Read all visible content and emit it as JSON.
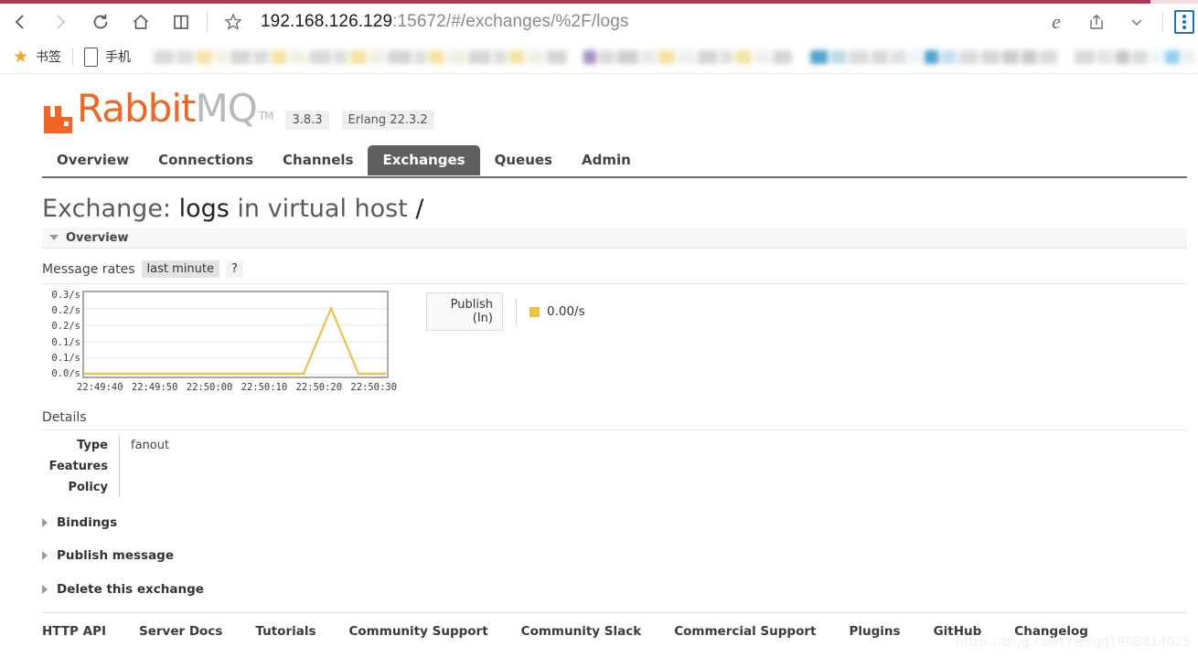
{
  "browser": {
    "loading_percent": 96,
    "back_icon": "back-chevron-icon",
    "forward_icon": "forward-chevron-icon",
    "reload_icon": "reload-icon",
    "home_icon": "home-icon",
    "reading_list_icon": "book-icon",
    "favorite_icon": "star-outline-icon",
    "url_host": "192.168.126.129",
    "url_rest": ":15672/#/exchanges/%2F/logs",
    "edge_icon": "edge-logo-icon",
    "share_icon": "share-icon",
    "more_icon": "chevron-down-icon",
    "extension_icon": "extension-icon"
  },
  "bookmarks": {
    "star_icon": "star-filled-icon",
    "bookmarks_label": "书签",
    "mobile_icon": "phone-icon",
    "mobile_label": "手机",
    "blurred_chips": [
      {
        "w": 34,
        "c": "#d8d8d8"
      },
      {
        "w": 30,
        "c": "#dedede"
      },
      {
        "w": 26,
        "c": "#f3e3a8"
      },
      {
        "w": 22,
        "c": "#f3f0e4"
      },
      {
        "w": 34,
        "c": "#d5d5d5"
      },
      {
        "w": 26,
        "c": "#dcdcdc"
      },
      {
        "w": 24,
        "c": "#f4e2a0"
      },
      {
        "w": 30,
        "c": "#f2efe6"
      },
      {
        "w": 36,
        "c": "#d9d9d9"
      },
      {
        "w": 24,
        "c": "#dddddd"
      },
      {
        "w": 28,
        "c": "#f4e3a2"
      },
      {
        "w": 26,
        "c": "#f1eee6"
      },
      {
        "w": 40,
        "c": "#d4d4d4"
      },
      {
        "w": 20,
        "c": "#dedede"
      },
      {
        "w": 26,
        "c": "#f4e2a0"
      },
      {
        "w": 32,
        "c": "#f0ede5"
      },
      {
        "w": 38,
        "c": "#d6d6d6"
      },
      {
        "w": 22,
        "c": "#dcdcdc"
      },
      {
        "w": 24,
        "c": "#f3e2a2"
      },
      {
        "w": 30,
        "c": "#f1eee7"
      },
      {
        "w": 34,
        "c": "#d6d6d6"
      },
      {
        "w": 18,
        "c": "#ffffff"
      },
      {
        "w": 22,
        "c": "#a98ec4"
      },
      {
        "w": 26,
        "c": "#d9d9d9"
      },
      {
        "w": 36,
        "c": "#cfcfcf"
      },
      {
        "w": 24,
        "c": "#e8e8e8"
      },
      {
        "w": 28,
        "c": "#f3e2a2"
      },
      {
        "w": 30,
        "c": "#efefef"
      },
      {
        "w": 34,
        "c": "#d4d4d4"
      },
      {
        "w": 20,
        "c": "#dedede"
      },
      {
        "w": 26,
        "c": "#f2e2a4"
      },
      {
        "w": 28,
        "c": "#f0f0ee"
      },
      {
        "w": 32,
        "c": "#d5d5d5"
      },
      {
        "w": 22,
        "c": "#ffffff"
      },
      {
        "w": 30,
        "c": "#4fa3cd"
      },
      {
        "w": 26,
        "c": "#bdd9e8"
      },
      {
        "w": 34,
        "c": "#dcdcdc"
      },
      {
        "w": 28,
        "c": "#d8d8d8"
      },
      {
        "w": 26,
        "c": "#e0e0e0"
      },
      {
        "w": 22,
        "c": "#eef5f8"
      },
      {
        "w": 22,
        "c": "#4fa3cd"
      },
      {
        "w": 26,
        "c": "#c3dded"
      },
      {
        "w": 34,
        "c": "#dcdcdc"
      },
      {
        "w": 30,
        "c": "#d6d6d6"
      },
      {
        "w": 28,
        "c": "#cccccc"
      },
      {
        "w": 26,
        "c": "#c9c9c9"
      },
      {
        "w": 30,
        "c": "#dadada"
      },
      {
        "w": 20,
        "c": "#ffffff"
      },
      {
        "w": 34,
        "c": "#d9d9d9"
      },
      {
        "w": 26,
        "c": "#e4e4e4"
      },
      {
        "w": 24,
        "c": "#c6c6c6"
      },
      {
        "w": 26,
        "c": "#dbdbdb"
      },
      {
        "w": 20,
        "c": "#e9f5fb"
      },
      {
        "w": 24,
        "c": "#8fd0ee"
      },
      {
        "w": 22,
        "c": "#eeeeee"
      }
    ]
  },
  "header": {
    "logo_rabbit": "Rabbit",
    "logo_mq": "MQ",
    "logo_tm": "TM",
    "version": "3.8.3",
    "erlang": "Erlang 22.3.2",
    "brand_color": "#f26522"
  },
  "nav": {
    "tabs": [
      {
        "label": "Overview",
        "active": false
      },
      {
        "label": "Connections",
        "active": false
      },
      {
        "label": "Channels",
        "active": false
      },
      {
        "label": "Exchanges",
        "active": true
      },
      {
        "label": "Queues",
        "active": false
      },
      {
        "label": "Admin",
        "active": false
      }
    ]
  },
  "main": {
    "title_prefix": "Exchange: ",
    "title_name": "logs",
    "title_middle": " in virtual host ",
    "title_vhost": "/",
    "overview_section": "Overview",
    "message_rates_label": "Message rates",
    "range_label": "last minute",
    "help_label": "?",
    "details_label": "Details",
    "details_rows": [
      {
        "key": "Type",
        "value": "fanout"
      },
      {
        "key": "Features",
        "value": ""
      },
      {
        "key": "Policy",
        "value": ""
      }
    ],
    "collapsibles": [
      {
        "label": "Bindings"
      },
      {
        "label": "Publish message"
      },
      {
        "label": "Delete this exchange"
      }
    ]
  },
  "chart_data": {
    "type": "line",
    "title": "Message rates",
    "xlabel": "",
    "ylabel": "",
    "ylim": [
      0,
      0.3
    ],
    "grid": true,
    "legend_position": "right",
    "ytick_labels": [
      "0.3/s",
      "0.2/s",
      "0.2/s",
      "0.1/s",
      "0.1/s",
      "0.0/s"
    ],
    "ytick_values": [
      0.3,
      0.25,
      0.2,
      0.15,
      0.1,
      0.0
    ],
    "xtick_labels": [
      "22:49:40",
      "22:49:50",
      "22:50:00",
      "22:50:10",
      "22:50:20",
      "22:50:30"
    ],
    "series": [
      {
        "name": "Publish (In)",
        "color": "#eac248",
        "current_value": "0.00/s",
        "x": [
          "22:49:40",
          "22:49:45",
          "22:49:50",
          "22:49:55",
          "22:50:00",
          "22:50:05",
          "22:50:10",
          "22:50:15",
          "22:50:20",
          "22:50:25",
          "22:50:30",
          "22:50:35"
        ],
        "values": [
          0,
          0,
          0,
          0,
          0,
          0,
          0,
          0,
          0,
          0.25,
          0,
          0
        ]
      }
    ]
  },
  "footer": {
    "links": [
      "HTTP API",
      "Server Docs",
      "Tutorials",
      "Community Support",
      "Community Slack",
      "Commercial Support",
      "Plugins",
      "GitHub",
      "Changelog"
    ]
  },
  "watermark": "https://blog.csdn.net/qq1808814025"
}
